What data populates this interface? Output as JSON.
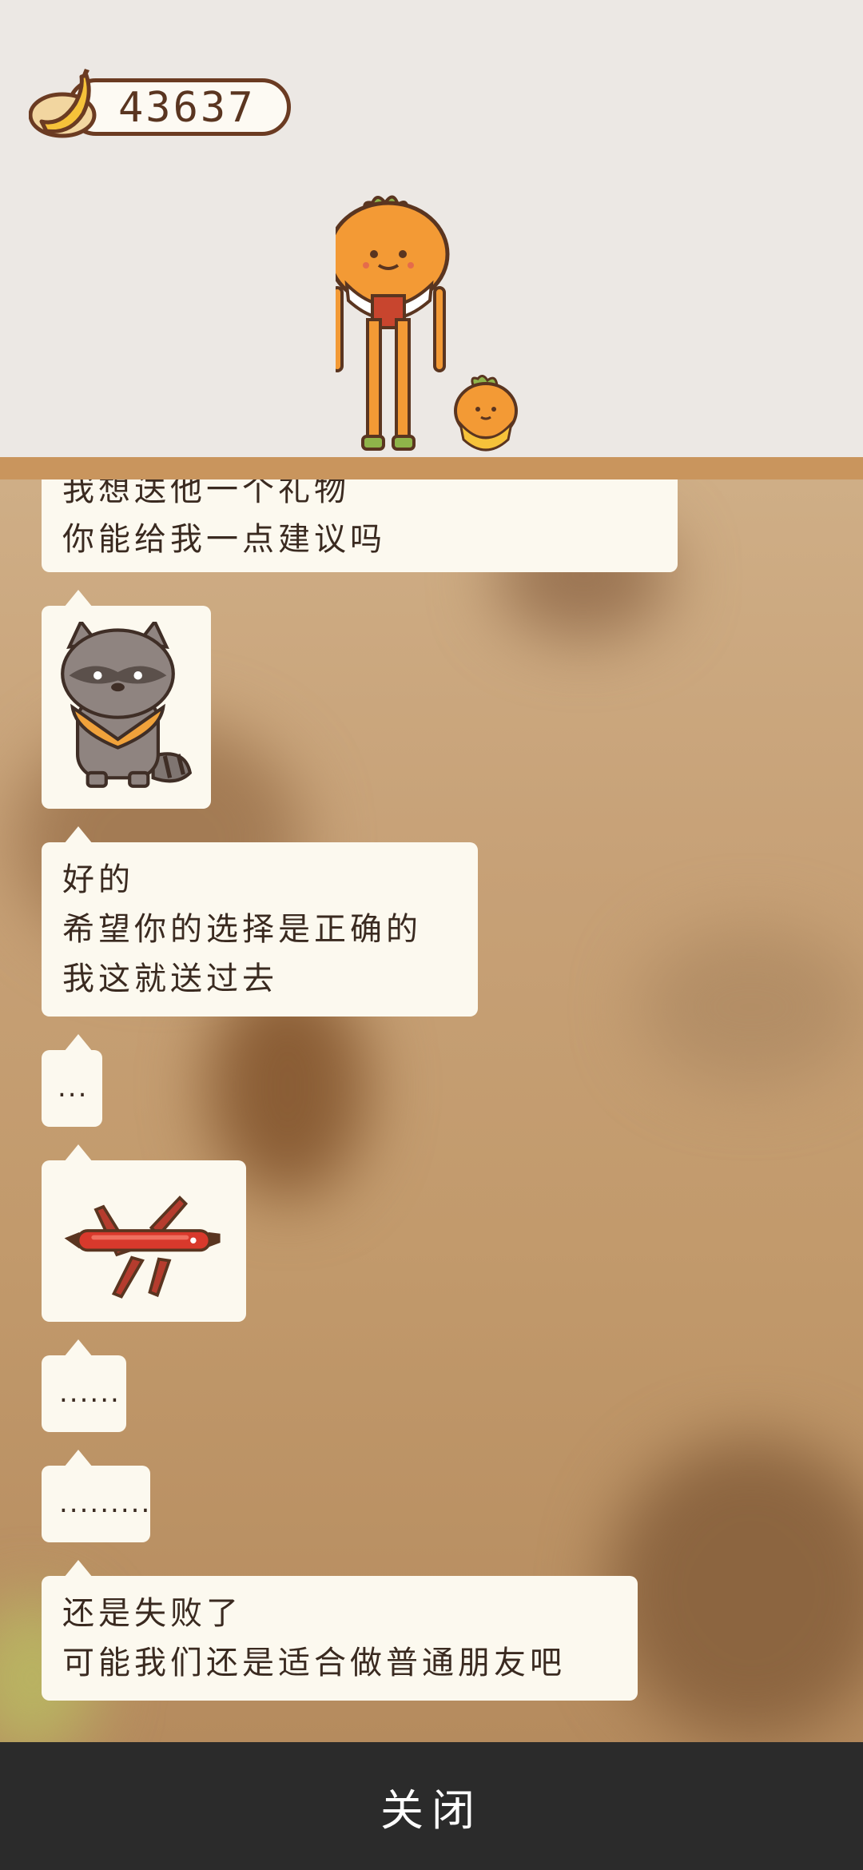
{
  "hud": {
    "banana_count": "43637",
    "currency_icon": "banana-icon"
  },
  "scene": {
    "characters": [
      "carrot-tall-character-icon",
      "carrot-small-character-icon"
    ]
  },
  "chat": {
    "messages": [
      {
        "type": "text",
        "lines": [
          "我想送他一个礼物",
          "你能给我一点建议吗"
        ]
      },
      {
        "type": "image",
        "icon": "raccoon-icon"
      },
      {
        "type": "text",
        "lines": [
          "好的",
          "希望你的选择是正确的",
          "我这就送过去"
        ]
      },
      {
        "type": "text",
        "lines": [
          "..."
        ]
      },
      {
        "type": "image",
        "icon": "swiss-army-knife-icon"
      },
      {
        "type": "text",
        "lines": [
          "......"
        ]
      },
      {
        "type": "text",
        "lines": [
          "........."
        ]
      },
      {
        "type": "text",
        "lines": [
          "还是失败了",
          "可能我们还是适合做普通朋友吧"
        ]
      }
    ]
  },
  "footer": {
    "close_label": "关闭"
  },
  "colors": {
    "bubble": "#fcf9ef",
    "text": "#3a2a20",
    "close_bar": "#2b2b2b",
    "floor": "#c9955d",
    "scene_bg": "#ece8e4"
  }
}
